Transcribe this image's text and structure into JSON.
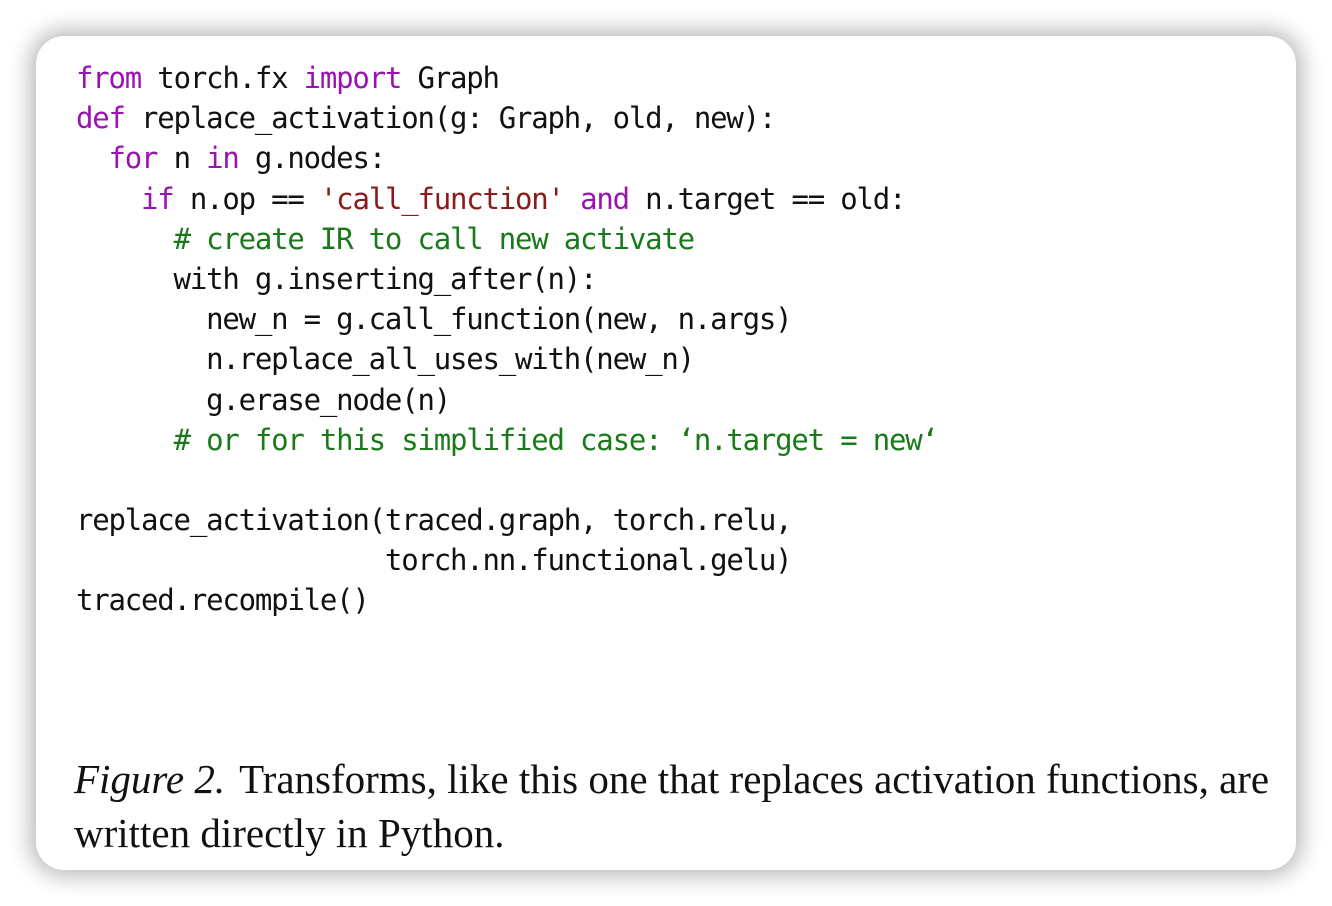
{
  "code": {
    "line1": {
      "kw1": "from",
      "t1": " torch.fx ",
      "kw2": "import",
      "t2": " Graph"
    },
    "line2": {
      "kw1": "def",
      "t1": " replace_activation(g: Graph, old, new):"
    },
    "line3": {
      "indent": "  ",
      "kw1": "for",
      "t1": " n ",
      "kw2": "in",
      "t2": " g.nodes:"
    },
    "line4": {
      "indent": "    ",
      "kw1": "if",
      "t1": " n.op == ",
      "str1": "'call_function'",
      "t2": " ",
      "kw2": "and",
      "t3": " n.target == old:"
    },
    "line5": {
      "indent": "      ",
      "comment": "# create IR to call new activate"
    },
    "line6": {
      "text": "      with g.inserting_after(n):"
    },
    "line7": {
      "text": "        new_n = g.call_function(new, n.args)"
    },
    "line8": {
      "text": "        n.replace_all_uses_with(new_n)"
    },
    "line9": {
      "text": "        g.erase_node(n)"
    },
    "line10": {
      "indent": "      ",
      "comment": "# or for this simplified case: ‘n.target = new‘"
    },
    "line11": {
      "text": ""
    },
    "line12": {
      "text": "replace_activation(traced.graph, torch.relu,"
    },
    "line13": {
      "text": "                   torch.nn.functional.gelu)"
    },
    "line14": {
      "text": "traced.recompile()"
    }
  },
  "caption": {
    "label": "Figure 2.",
    "text": "Transforms, like this one that replaces activation functions, are written directly in Python."
  }
}
